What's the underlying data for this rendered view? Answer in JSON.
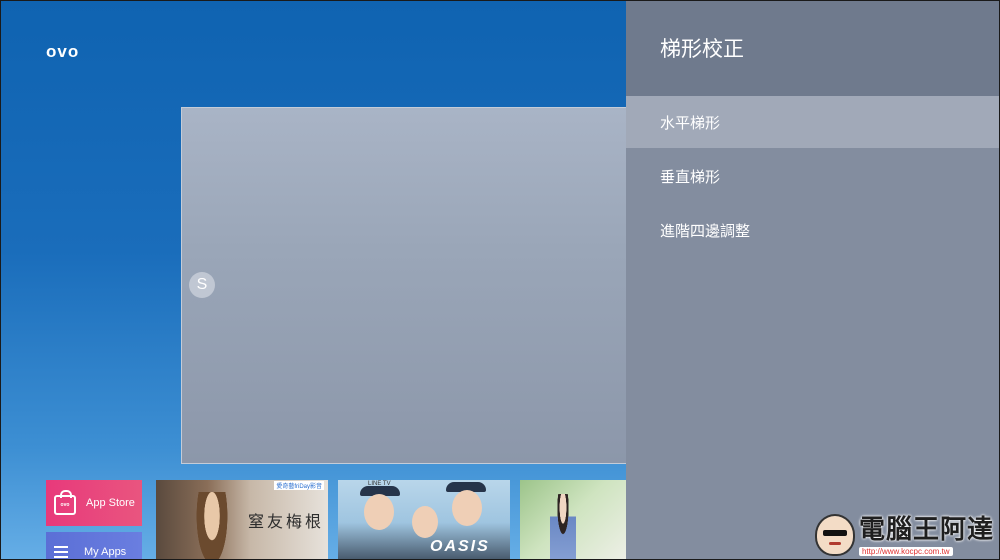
{
  "launcher": {
    "logo": "ovo",
    "preview_avatar": "S",
    "tiles": {
      "app_store_label": "App Store",
      "app_store_icon_text": "ovo",
      "my_apps_label": "My Apps",
      "poster1_brand": "愛奇藝friDay影音",
      "poster1_title": "窒友梅根",
      "poster2_brand": "LINE TV",
      "poster2_title": "OASIS"
    }
  },
  "settings_menu": {
    "title": "梯形校正",
    "items": [
      {
        "label": "水平梯形",
        "selected": true
      },
      {
        "label": "垂直梯形",
        "selected": false
      },
      {
        "label": "進階四邊調整",
        "selected": false
      }
    ]
  },
  "watermark": {
    "title": "電腦王阿達",
    "url": "http://www.kocpc.com.tw"
  },
  "colors": {
    "background": "#1a6dbb",
    "menu_panel": "#838d9f",
    "menu_header": "#6f7a8d",
    "menu_selected": "#a1a9b8",
    "app_store_tile": "#e8397b",
    "my_apps_tile": "#5b6fd6"
  }
}
